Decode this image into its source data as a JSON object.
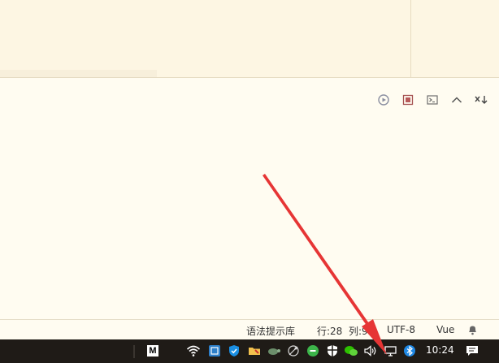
{
  "editor_toolbar": {
    "buttons": [
      {
        "id": "run",
        "icon": "run-icon"
      },
      {
        "id": "stop",
        "icon": "stop-icon"
      },
      {
        "id": "terminal",
        "icon": "terminal-icon"
      },
      {
        "id": "collapse",
        "icon": "chevron-up-icon"
      },
      {
        "id": "clear",
        "icon": "clear-output-icon"
      }
    ]
  },
  "status_bar": {
    "grammar_library": "语法提示库",
    "line": "行:28",
    "column": "列:9",
    "encoding": "UTF-8",
    "language": "Vue"
  },
  "taskbar": {
    "clock": "10:24",
    "tray_icons": [
      "m-app-icon",
      "wifi-icon",
      "network-app-icon",
      "shield-icon",
      "folder-app-icon",
      "turtle-app-icon",
      "satellite-icon",
      "green-app-icon",
      "security-icon",
      "wechat-icon",
      "volume-icon",
      "network-display-icon",
      "bluetooth-icon",
      "notification-icon"
    ]
  },
  "colors": {
    "annotation_arrow": "#e63535",
    "taskbar_bg": "#1f1b17",
    "editor_bg": "#fffcf1"
  }
}
